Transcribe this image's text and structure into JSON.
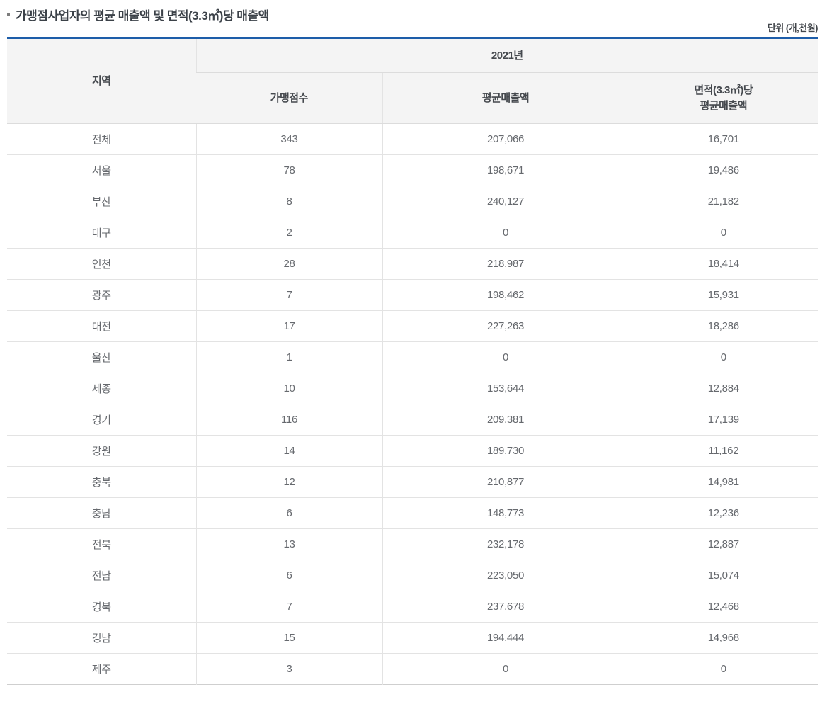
{
  "header": {
    "title": "가맹점사업자의 평균 매출액 및 면적(3.3㎡)당 매출액",
    "unit_note": "단위 (개,천원)"
  },
  "colors": {
    "accent_blue": "#1d5da9",
    "header_bg": "#f4f4f4",
    "row_border": "#e3e3e3",
    "bottom_border": "#cfcfcf",
    "data_text": "#66696e",
    "header_text": "#45494e"
  },
  "table": {
    "region_header": "지역",
    "year_group_header": "2021년",
    "sub_headers": {
      "store_count": "가맹점수",
      "avg_sales": "평균매출액",
      "per_area_line1": "면적(3.3㎡)당",
      "per_area_line2": "평균매출액"
    },
    "rows": [
      {
        "region": "전체",
        "store_count": "343",
        "avg_sales": "207,066",
        "per_area_sales": "16,701"
      },
      {
        "region": "서울",
        "store_count": "78",
        "avg_sales": "198,671",
        "per_area_sales": "19,486"
      },
      {
        "region": "부산",
        "store_count": "8",
        "avg_sales": "240,127",
        "per_area_sales": "21,182"
      },
      {
        "region": "대구",
        "store_count": "2",
        "avg_sales": "0",
        "per_area_sales": "0"
      },
      {
        "region": "인천",
        "store_count": "28",
        "avg_sales": "218,987",
        "per_area_sales": "18,414"
      },
      {
        "region": "광주",
        "store_count": "7",
        "avg_sales": "198,462",
        "per_area_sales": "15,931"
      },
      {
        "region": "대전",
        "store_count": "17",
        "avg_sales": "227,263",
        "per_area_sales": "18,286"
      },
      {
        "region": "울산",
        "store_count": "1",
        "avg_sales": "0",
        "per_area_sales": "0"
      },
      {
        "region": "세종",
        "store_count": "10",
        "avg_sales": "153,644",
        "per_area_sales": "12,884"
      },
      {
        "region": "경기",
        "store_count": "116",
        "avg_sales": "209,381",
        "per_area_sales": "17,139"
      },
      {
        "region": "강원",
        "store_count": "14",
        "avg_sales": "189,730",
        "per_area_sales": "11,162"
      },
      {
        "region": "충북",
        "store_count": "12",
        "avg_sales": "210,877",
        "per_area_sales": "14,981"
      },
      {
        "region": "충남",
        "store_count": "6",
        "avg_sales": "148,773",
        "per_area_sales": "12,236"
      },
      {
        "region": "전북",
        "store_count": "13",
        "avg_sales": "232,178",
        "per_area_sales": "12,887"
      },
      {
        "region": "전남",
        "store_count": "6",
        "avg_sales": "223,050",
        "per_area_sales": "15,074"
      },
      {
        "region": "경북",
        "store_count": "7",
        "avg_sales": "237,678",
        "per_area_sales": "12,468"
      },
      {
        "region": "경남",
        "store_count": "15",
        "avg_sales": "194,444",
        "per_area_sales": "14,968"
      },
      {
        "region": "제주",
        "store_count": "3",
        "avg_sales": "0",
        "per_area_sales": "0"
      }
    ]
  }
}
